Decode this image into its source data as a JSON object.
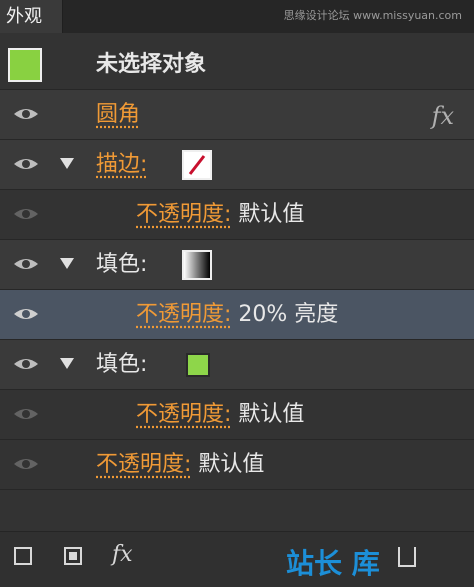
{
  "tab": {
    "label": "外观"
  },
  "watermark": "思缘设计论坛 www.missyuan.com",
  "rows": {
    "header": {
      "label": "未选择对象"
    },
    "rounded": {
      "label": "圆角",
      "fx": "fx"
    },
    "stroke": {
      "label": "描边:"
    },
    "stroke_opacity": {
      "label": "不透明度:",
      "value": " 默认值"
    },
    "fill1": {
      "label": "填色:"
    },
    "fill1_opacity": {
      "label": "不透明度:",
      "value": " 20% 亮度"
    },
    "fill2": {
      "label": "填色:"
    },
    "fill2_opacity": {
      "label": "不透明度:",
      "value": " 默认值"
    },
    "opacity": {
      "label": "不透明度:",
      "value": " 默认值"
    }
  },
  "footer": {
    "fx": "fx",
    "logo": "站长 库"
  },
  "colors": {
    "accent": "#f09a36",
    "green": "#8ed64a",
    "selected": "#4b5563"
  }
}
